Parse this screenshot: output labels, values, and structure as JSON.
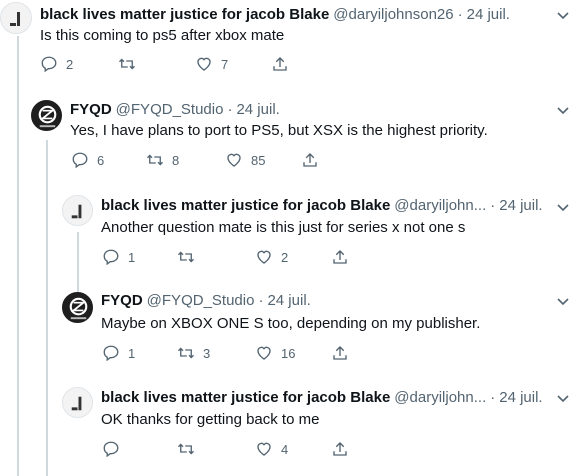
{
  "tweets": [
    {
      "name": "black lives matter justice for jacob Blake",
      "handle": "@daryiljohnson26",
      "dot": "·",
      "date": "24 juil.",
      "text": "Is this coming to ps5 after xbox mate",
      "replies": "2",
      "retweets": "",
      "likes": "7"
    },
    {
      "name": "FYQD",
      "handle": "@FYQD_Studio",
      "dot": "·",
      "date": "24 juil.",
      "text": "Yes, I have plans to port to PS5, but XSX is the highest priority.",
      "replies": "6",
      "retweets": "8",
      "likes": "85"
    },
    {
      "name": "black lives matter justice for jacob Blake",
      "handle": "@daryiljohn...",
      "dot": "·",
      "date": "24 juil.",
      "text": "Another question mate is this just for series x not one s",
      "replies": "1",
      "retweets": "",
      "likes": "2"
    },
    {
      "name": "FYQD",
      "handle": "@FYQD_Studio",
      "dot": "·",
      "date": "24 juil.",
      "text": "Maybe on XBOX ONE S too, depending on my publisher.",
      "replies": "1",
      "retweets": "3",
      "likes": "16"
    },
    {
      "name": "black lives matter justice for jacob Blake",
      "handle": "@daryiljohn...",
      "dot": "·",
      "date": "24 juil.",
      "text": "OK thanks for getting back to me",
      "replies": "",
      "retweets": "",
      "likes": "4"
    }
  ],
  "colors": {
    "text": "#0f1419",
    "secondary": "#536471",
    "thread_line": "#cfd9de"
  },
  "icons": [
    "reply-icon",
    "retweet-icon",
    "like-icon",
    "share-icon",
    "caret-down-icon"
  ]
}
